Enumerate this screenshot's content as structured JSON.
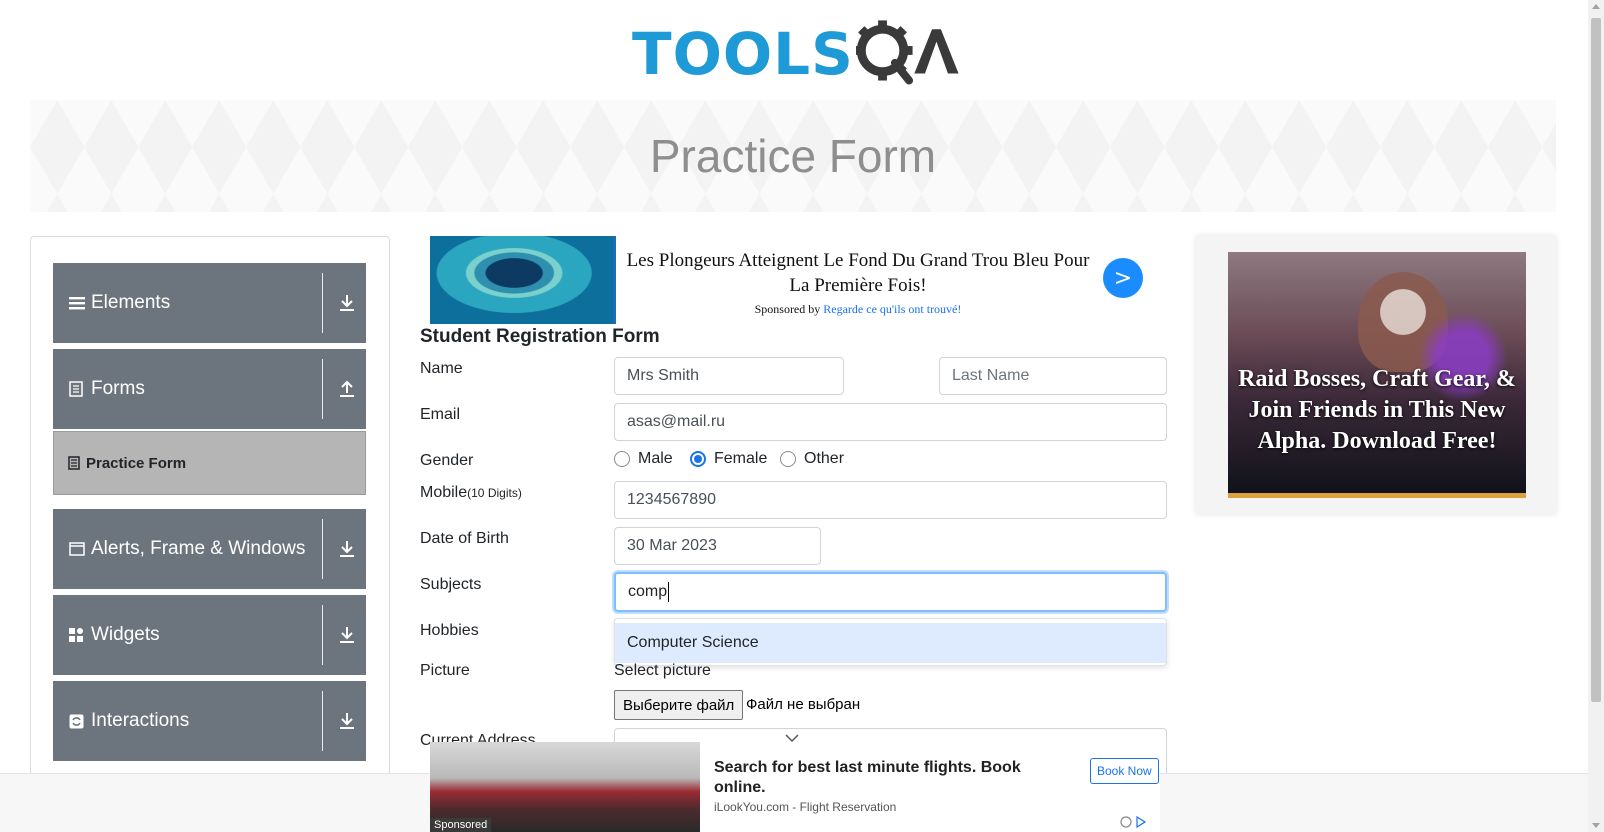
{
  "logo": {
    "text": "TOOLS",
    "accent": "QA",
    "colors": {
      "tools": "#1e9ad6",
      "qa": "#3a3a3a"
    }
  },
  "banner": {
    "title": "Practice Form"
  },
  "sidebar": {
    "groups": [
      {
        "label": "Elements",
        "icon": "hamburger-icon",
        "arrow": "download-arrow-icon"
      },
      {
        "label": "Forms",
        "icon": "document-icon",
        "arrow": "upload-arrow-icon"
      },
      {
        "label": "Alerts, Frame & Windows",
        "icon": "window-icon",
        "arrow": "download-arrow-icon"
      },
      {
        "label": "Widgets",
        "icon": "widgets-grid-icon",
        "arrow": "download-arrow-icon"
      },
      {
        "label": "Interactions",
        "icon": "interactions-icon",
        "arrow": "download-arrow-icon"
      }
    ],
    "active_item": {
      "label": "Practice Form",
      "icon": "document-small-icon"
    },
    "colors": {
      "group_bg": "#6c757d",
      "active_bg": "#b5b5b5"
    }
  },
  "ad_top": {
    "title": "Les Plongeurs Atteignent Le Fond Du Grand Trou Bleu Pour La Première Fois!",
    "sponsored_prefix": "Sponsored by",
    "sponsor_link": "Regarde ce qu'ils ont trouvé!",
    "go_label": ">"
  },
  "form": {
    "title": "Student Registration Form",
    "name": {
      "label": "Name",
      "first_value": "Mrs Smith",
      "last_placeholder": "Last Name"
    },
    "email": {
      "label": "Email",
      "value": "asas@mail.ru"
    },
    "gender": {
      "label": "Gender",
      "options": [
        "Male",
        "Female",
        "Other"
      ],
      "selected": "Female"
    },
    "mobile": {
      "label": "Mobile",
      "hint": "(10 Digits)",
      "value": "1234567890"
    },
    "dob": {
      "label": "Date of Birth",
      "value": "30 Mar 2023"
    },
    "subjects": {
      "label": "Subjects",
      "value": "comp",
      "suggestion": "Computer Science"
    },
    "hobbies": {
      "label": "Hobbies"
    },
    "picture": {
      "label": "Picture",
      "select_label": "Select picture",
      "button": "Выберите файл",
      "status": "Файл не выбран"
    },
    "address": {
      "label": "Current Address"
    }
  },
  "ad_right": {
    "text": "Raid Bosses, Craft Gear, & Join Friends in This New Alpha. Download Free!"
  },
  "ad_bottom": {
    "title": "Search for best last minute flights. Book online.",
    "source": "iLookYou.com - Flight Reservation",
    "button": "Book Now",
    "sponsored": "Sponsored"
  }
}
